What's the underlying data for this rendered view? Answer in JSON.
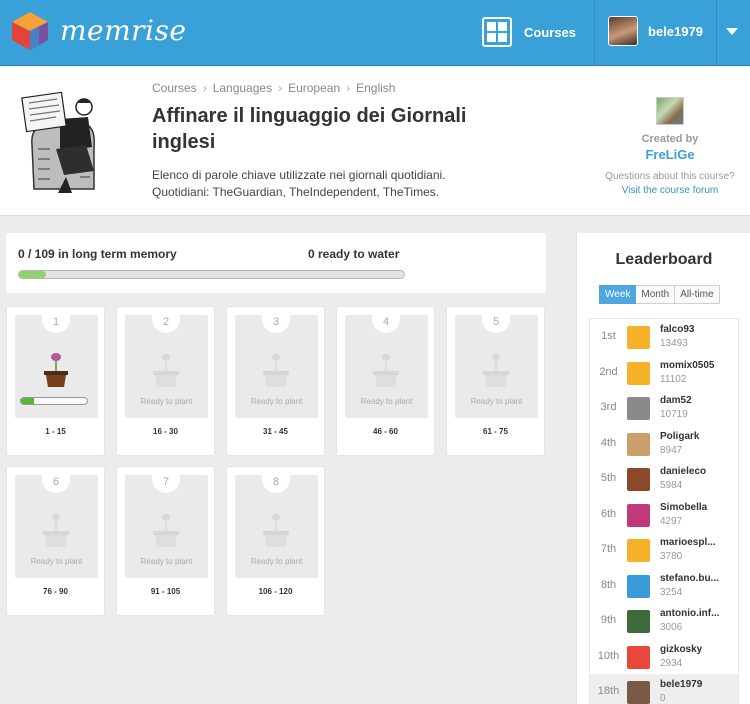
{
  "topbar": {
    "logo_text": "memrise",
    "courses_label": "Courses",
    "username": "bele1979",
    "colors": {
      "bar": "#3aa0d8",
      "text": "#ffffff"
    }
  },
  "course": {
    "breadcrumb": [
      "Courses",
      "Languages",
      "European",
      "English"
    ],
    "title": "Affinare il linguaggio dei Giornali inglesi",
    "description": "Elenco di parole chiave utilizzate nei giornali quotidiani. Quotidiani: TheGuardian, TheIndependent, TheTimes.",
    "created_by_label": "Created by",
    "creator": "FreLiGe",
    "questions_text": "Questions about this course?",
    "forum_link": "Visit the course forum"
  },
  "progress": {
    "memory_text": "0 / 109 in long term memory",
    "water_text": "0 ready to water",
    "fraction": 0.07
  },
  "levels": [
    {
      "num": "1",
      "range": "1 - 15",
      "status": "",
      "progress": 0.2,
      "icon": "flower-pot-icon"
    },
    {
      "num": "2",
      "range": "16 - 30",
      "status": "Ready to plant",
      "icon": "seedling-pot-icon"
    },
    {
      "num": "3",
      "range": "31 - 45",
      "status": "Ready to plant",
      "icon": "seedling-pot-icon"
    },
    {
      "num": "4",
      "range": "46 - 60",
      "status": "Ready to plant",
      "icon": "seedling-pot-icon"
    },
    {
      "num": "5",
      "range": "61 - 75",
      "status": "Ready to plant",
      "icon": "seedling-pot-icon"
    },
    {
      "num": "6",
      "range": "76 - 90",
      "status": "Ready to plant",
      "icon": "seedling-pot-icon"
    },
    {
      "num": "7",
      "range": "91 - 105",
      "status": "Ready to plant",
      "icon": "seedling-pot-icon"
    },
    {
      "num": "8",
      "range": "106 - 120",
      "status": "Ready to plant",
      "icon": "seedling-pot-icon"
    }
  ],
  "leaderboard": {
    "title": "Leaderboard",
    "tabs": [
      "Week",
      "Month",
      "All-time"
    ],
    "active_tab": "Week",
    "rows": [
      {
        "rank": "1st",
        "name": "falco93",
        "points": "13493",
        "color": "#f5b127"
      },
      {
        "rank": "2nd",
        "name": "momix0505",
        "points": "11102",
        "color": "#f5b127"
      },
      {
        "rank": "3rd",
        "name": "dam52",
        "points": "10719",
        "color": "#8a8a8a"
      },
      {
        "rank": "4th",
        "name": "Poligark",
        "points": "8947",
        "color": "#c9a06a"
      },
      {
        "rank": "5th",
        "name": "danieleco",
        "points": "5984",
        "color": "#8a4a2a"
      },
      {
        "rank": "6th",
        "name": "Simobella",
        "points": "4297",
        "color": "#c0397a"
      },
      {
        "rank": "7th",
        "name": "marioespl...",
        "points": "3780",
        "color": "#f5b127"
      },
      {
        "rank": "8th",
        "name": "stefano.bu...",
        "points": "3254",
        "color": "#3a9bd8"
      },
      {
        "rank": "9th",
        "name": "antonio.inf...",
        "points": "3006",
        "color": "#3e6b3a"
      },
      {
        "rank": "10th",
        "name": "gizkosky",
        "points": "2934",
        "color": "#e8483a"
      },
      {
        "rank": "18th",
        "name": "bele1979",
        "points": "0",
        "color": "#7a5a45",
        "is_me": true
      }
    ]
  }
}
